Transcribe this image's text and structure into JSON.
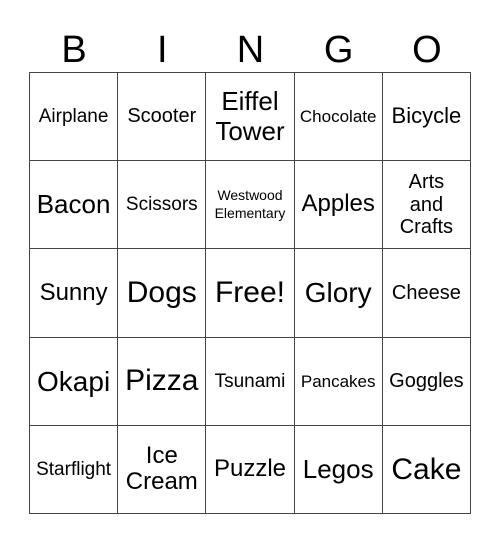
{
  "header": {
    "letters": [
      "B",
      "I",
      "N",
      "G",
      "O"
    ]
  },
  "grid": {
    "rows": [
      [
        "Airplane",
        "Scooter",
        "Eiffel Tower",
        "Chocolate",
        "Bicycle"
      ],
      [
        "Bacon",
        "Scissors",
        "Westwood Elementary",
        "Apples",
        "Arts and Crafts"
      ],
      [
        "Sunny",
        "Dogs",
        "Free!",
        "Glory",
        "Cheese"
      ],
      [
        "Okapi",
        "Pizza",
        "Tsunami",
        "Pancakes",
        "Goggles"
      ],
      [
        "Starflight",
        "Ice Cream",
        "Puzzle",
        "Legos",
        "Cake"
      ]
    ],
    "free_space": "Free!"
  }
}
